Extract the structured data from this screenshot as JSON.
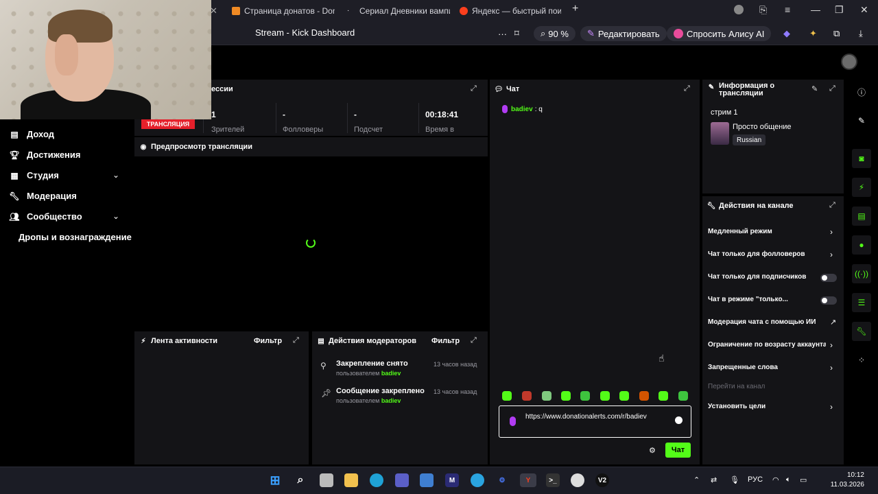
{
  "browser": {
    "tabs": [
      {
        "label": "Страница донатов - Dona"
      },
      {
        "label": "Сериал Дневники вампир"
      },
      {
        "label": "Яндекс — быстрый поиск"
      }
    ],
    "page_title": "Stream - Kick Dashboard",
    "zoom": "90 %",
    "edit_label": "Редактировать",
    "alice_label": "Спросить Алису AI"
  },
  "sidebar": {
    "items": [
      {
        "label": "Доход",
        "icon": "income-icon"
      },
      {
        "label": "Достижения",
        "icon": "trophy-icon"
      },
      {
        "label": "Студия",
        "icon": "studio-icon"
      },
      {
        "label": "Модерация",
        "icon": "wrench-icon"
      },
      {
        "label": "Сообщество",
        "icon": "community-icon"
      },
      {
        "label": "Дропы и вознаграждение",
        "icon": ""
      }
    ]
  },
  "session": {
    "title_fragment": "ессии",
    "live_badge": "ТРАНСЛЯЦИЯ",
    "stats": [
      {
        "value": "1",
        "label": "Зрителей"
      },
      {
        "value": "-",
        "label": "Фолловеры"
      },
      {
        "value": "-",
        "label": "Подсчет"
      },
      {
        "value": "00:18:41",
        "label": "Время в"
      }
    ]
  },
  "preview": {
    "title": "Предпросмотр трансляции"
  },
  "activity": {
    "title": "Лента активности",
    "filter": "Фильтр"
  },
  "mod_actions": {
    "title": "Действия модераторов",
    "filter": "Фильтр",
    "rows": [
      {
        "title": "Закрепление снято",
        "by": "пользователем",
        "user": "badiev",
        "time": "13 часов назад"
      },
      {
        "title": "Сообщение закреплено",
        "by": "пользователем",
        "user": "badiev",
        "time": "13 часов назад"
      }
    ]
  },
  "chat": {
    "title": "Чат",
    "messages": [
      {
        "user": "badiev",
        "text": ": q"
      }
    ],
    "input_value": "https://www.donationalerts.com/r/badiev",
    "send_label": "Чат"
  },
  "stream_info": {
    "title": "Информация о трансляции",
    "stream_name": "стрим 1",
    "category": "Просто общение",
    "language": "Russian"
  },
  "channel_actions": {
    "title": "Действия на канале",
    "rows": [
      {
        "label": "Медленный режим",
        "control": "chevron"
      },
      {
        "label": "Чат только для фолловеров",
        "control": "chevron"
      },
      {
        "label": "Чат только для подписчиков",
        "control": "toggle"
      },
      {
        "label": "Чат в режиме \"только...",
        "control": "toggle"
      },
      {
        "label": "Модерация чата с помощью ИИ",
        "control": "external"
      },
      {
        "label": "Ограничение по возрасту аккаунта",
        "control": "chevron"
      },
      {
        "label": "Запрещенные слова",
        "control": "chevron"
      },
      {
        "label": "Перейти на канал",
        "control": "none"
      },
      {
        "label": "Установить цели",
        "control": "chevron"
      }
    ]
  },
  "taskbar": {
    "lang": "РУС",
    "time": "10:12",
    "date": "11.03.2026",
    "v2_label": "V2"
  },
  "colors": {
    "accent": "#53fc18",
    "live": "#e5202b",
    "panel": "#141417"
  }
}
